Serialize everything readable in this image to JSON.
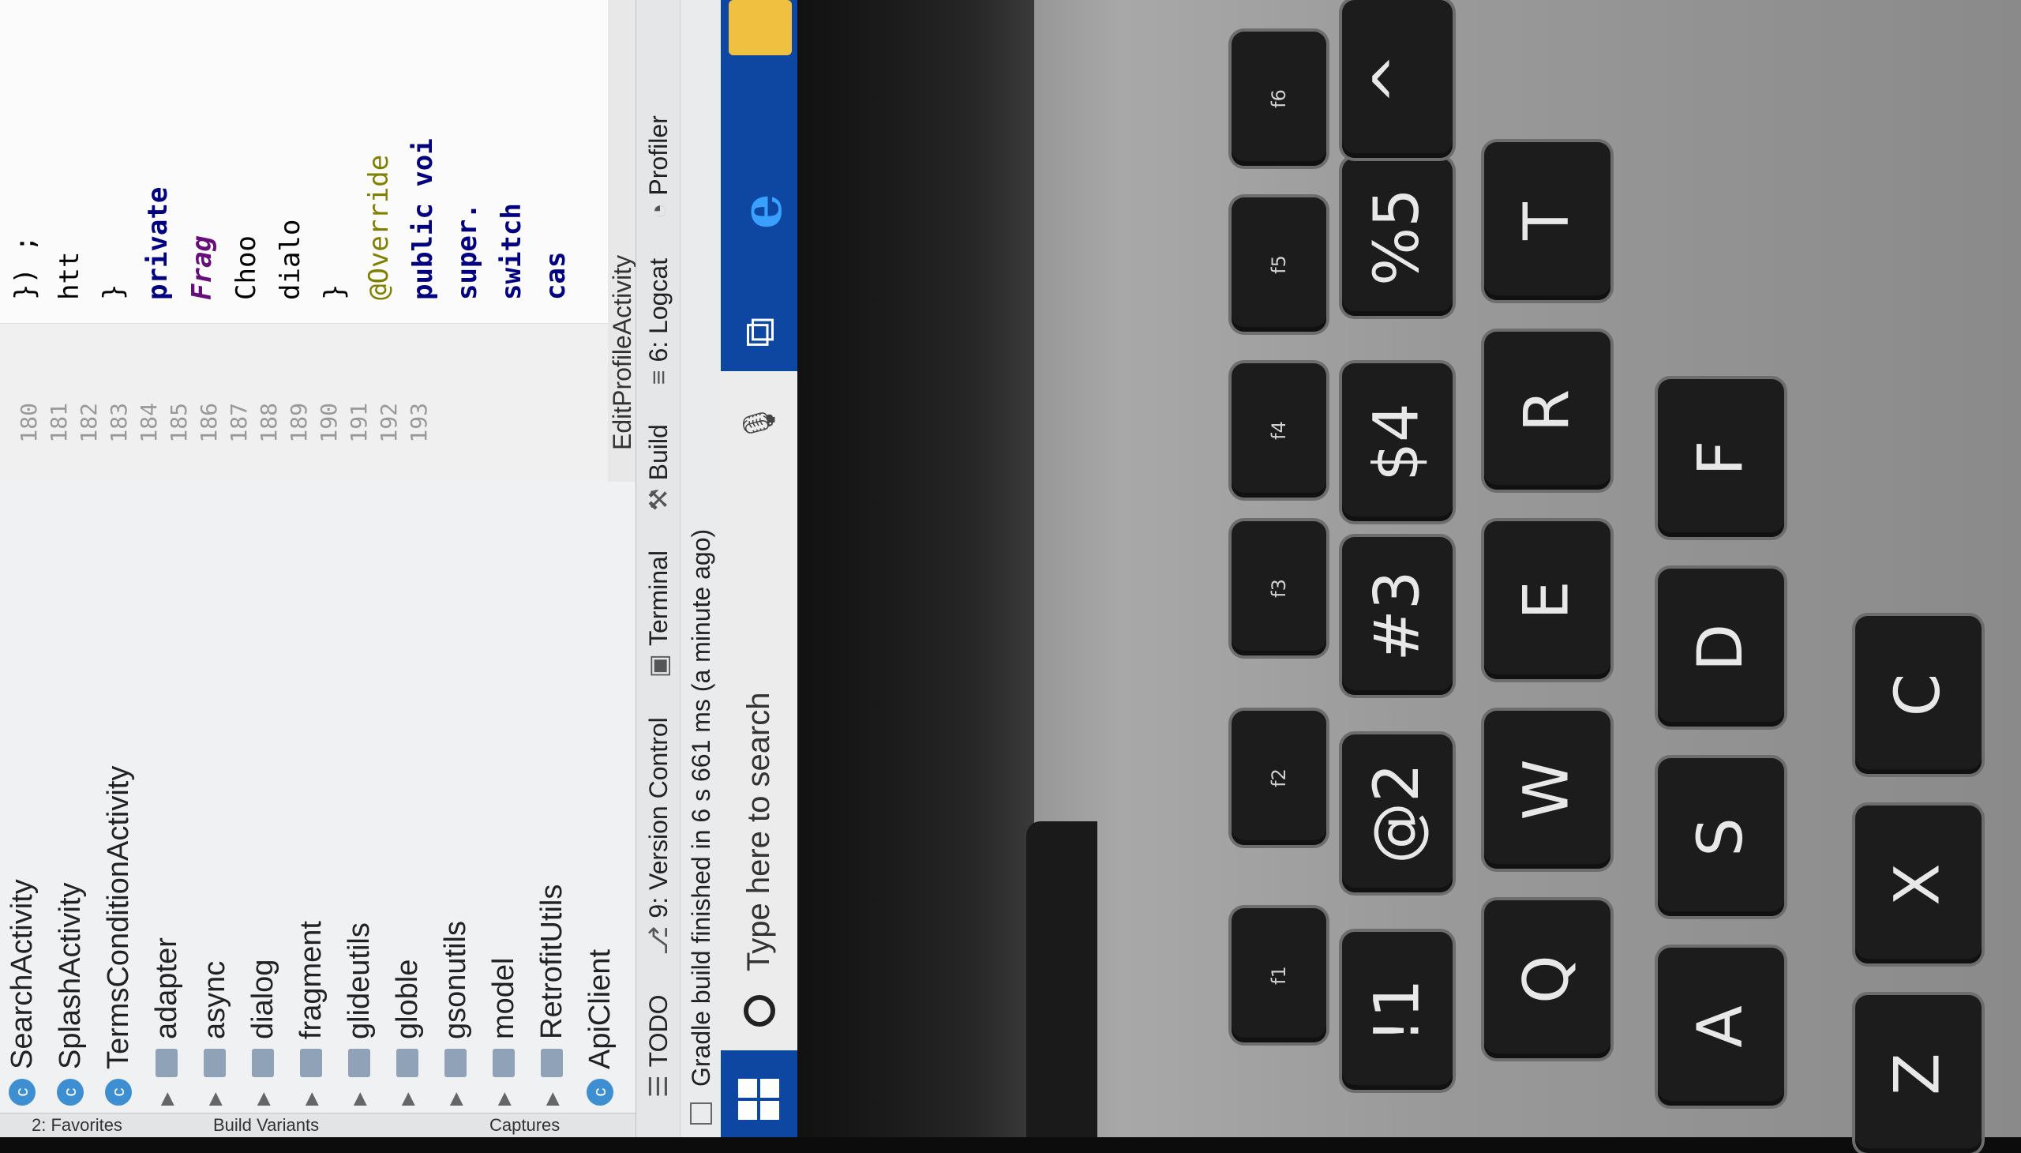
{
  "sidebar": {
    "favorites_tab": "2: Favorites",
    "build_variants_tab": "Build Variants",
    "captures_tab": "Captures"
  },
  "project_tree": {
    "items": [
      {
        "kind": "class",
        "label": "SearchActivity"
      },
      {
        "kind": "class",
        "label": "SplashActivity"
      },
      {
        "kind": "class",
        "label": "TermsConditionActivity"
      },
      {
        "kind": "package",
        "label": "adapter"
      },
      {
        "kind": "package",
        "label": "async"
      },
      {
        "kind": "package",
        "label": "dialog"
      },
      {
        "kind": "package",
        "label": "fragment"
      },
      {
        "kind": "package",
        "label": "glideutils"
      },
      {
        "kind": "package",
        "label": "globle"
      },
      {
        "kind": "package",
        "label": "gsonutils"
      },
      {
        "kind": "package",
        "label": "model"
      },
      {
        "kind": "package",
        "label": "RetrofitUtils"
      },
      {
        "kind": "class",
        "label": "ApiClient"
      }
    ],
    "class_glyph": "c"
  },
  "editor": {
    "line_numbers": [
      "180",
      "181",
      "182",
      "183",
      "184",
      "185",
      "186",
      "187",
      "188",
      "189",
      "190",
      "191",
      "192",
      "193"
    ],
    "code_lines": [
      "}) ;",
      "htt",
      "}",
      "private",
      "Frag",
      "Choo",
      "dialo",
      "}",
      "@Override",
      "public voi",
      "super.",
      "switch",
      "cas"
    ],
    "file_tab": "EditProfileActivity"
  },
  "tool_windows": {
    "todo": "TODO",
    "version_control": "9: Version Control",
    "terminal": "Terminal",
    "build": "Build",
    "logcat": "6: Logcat",
    "profiler": "Profiler"
  },
  "status_bar": {
    "message": "Gradle build finished in 6 s 661 ms (a minute ago)"
  },
  "taskbar": {
    "search_placeholder": "Type here to search",
    "accent": "#0d47a1"
  },
  "keyboard": {
    "function_keys": [
      "f1",
      "f2",
      "f3",
      "f4",
      "f5",
      "f6"
    ],
    "number_row": [
      "!1",
      "@2",
      "#3",
      "$4",
      "%5",
      "^"
    ],
    "letter_rows": [
      [
        "Q",
        "W",
        "E",
        "R",
        "T"
      ],
      [
        "A",
        "S",
        "D",
        "F"
      ],
      [
        "Z",
        "X",
        "C"
      ]
    ]
  }
}
